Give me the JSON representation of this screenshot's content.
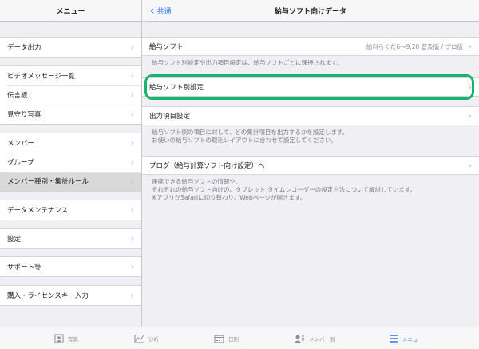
{
  "sidebar": {
    "title": "メニュー",
    "items": [
      {
        "label": "データ出力"
      },
      {
        "label": "ビデオメッセージ一覧"
      },
      {
        "label": "伝言板"
      },
      {
        "label": "見守り写真"
      },
      {
        "label": "メンバー"
      },
      {
        "label": "グループ"
      },
      {
        "label": "メンバー種別・集計ルール"
      },
      {
        "label": "データメンテナンス"
      },
      {
        "label": "設定"
      },
      {
        "label": "サポート等"
      },
      {
        "label": "購入・ライセンスキー入力"
      }
    ]
  },
  "header": {
    "back_label": "共通",
    "title": "給与ソフト向けデータ"
  },
  "main": {
    "software": {
      "label": "給与ソフト",
      "value": "給料らくだ6〜9,20 普及版 / プロ版"
    },
    "software_note": "給与ソフト別設定や出力項目設定は、給与ソフトごとに保持されます。",
    "per_software_settings": "給与ソフト別設定",
    "output_settings": "出力項目設定",
    "output_note": [
      "給与ソフト側の項目に対して、どの集計項目を出力するかを設定します。",
      "お使いの給与ソフトの取込レイアウトに合わせて設定してください。"
    ],
    "blog": "ブログ（給与計算ソフト向け設定）へ",
    "blog_note": [
      "連携できる給与ソフトの情報や、",
      "それぞれの給与ソフト向けの、タブレット タイムレコーダーの設定方法について解説しています。",
      "※アプリがSafariに切り替わり、Webページが開きます。"
    ]
  },
  "tabbar": {
    "tabs": [
      {
        "label": "写真",
        "icon": "photo-icon"
      },
      {
        "label": "分析",
        "icon": "chart-icon"
      },
      {
        "label": "日別",
        "icon": "calendar-icon"
      },
      {
        "label": "メンバー別",
        "icon": "member-icon"
      },
      {
        "label": "メニュー",
        "icon": "menu-icon"
      }
    ],
    "active_color": "#2f7bf5"
  },
  "colors": {
    "highlight": "#18b46d",
    "link": "#2f7bf5"
  }
}
